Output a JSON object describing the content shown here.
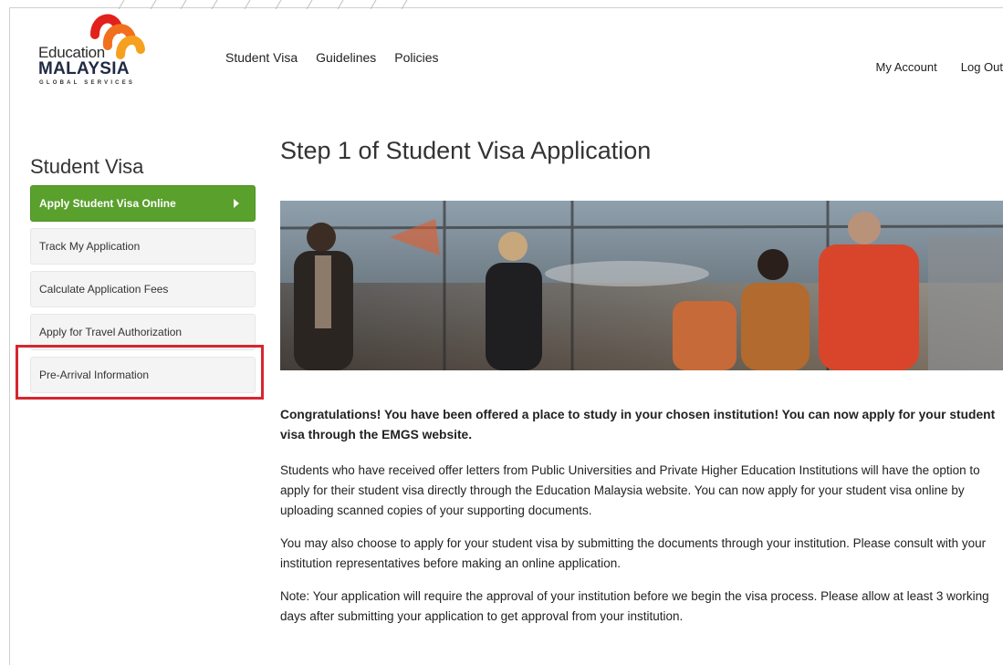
{
  "header": {
    "logo": {
      "line1": "Education",
      "line2": "MALAYSIA",
      "line3": "GLOBAL SERVICES"
    },
    "nav": [
      "Student Visa",
      "Guidelines",
      "Policies"
    ],
    "account": {
      "my_account": "My Account",
      "logout": "Log Out"
    }
  },
  "sidebar": {
    "title": "Student Visa",
    "items": [
      {
        "label": "Apply Student Visa Online",
        "active": true
      },
      {
        "label": "Track My Application"
      },
      {
        "label": "Calculate Application Fees"
      },
      {
        "label": "Apply for Travel Authorization"
      },
      {
        "label": "Pre-Arrival Information",
        "highlighted": true
      }
    ]
  },
  "main": {
    "title": "Step 1 of Student Visa Application",
    "hero_image": "students-at-airport-photo",
    "lead": "Congratulations! You have been offered a place to study in your chosen institution! You can now apply for your student visa through the EMGS website.",
    "paragraphs": [
      "Students who have received offer letters from Public Universities and Private Higher Education Institutions will have the option to apply for their student visa directly through the Education Malaysia website. You can now apply for your student visa online by uploading scanned copies of your supporting documents.",
      "You may also choose to apply for your student visa by submitting the documents through your institution. Please consult with your institution representatives before making an online application.",
      "Note: Your application will require the approval of your institution before we begin the visa process. Please allow at least 3 working days after submitting your application to get approval from your institution."
    ]
  },
  "colors": {
    "accent": "#5aa02c",
    "highlight": "#d6262f"
  }
}
